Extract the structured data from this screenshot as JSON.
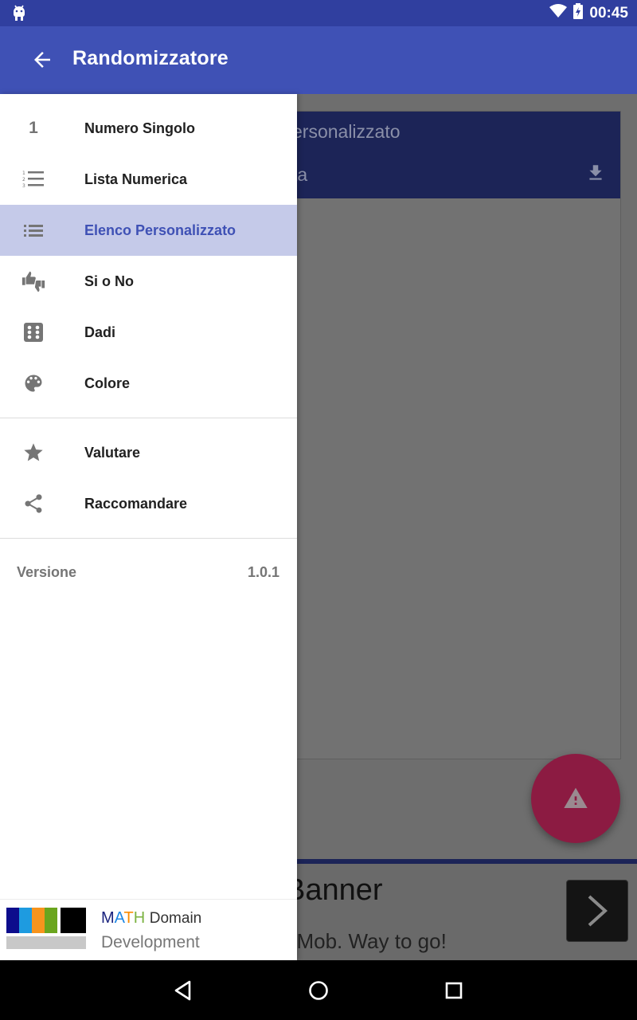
{
  "status_bar": {
    "time": "00:45",
    "icons": [
      "android-icon",
      "wifi-icon",
      "battery-charging-icon"
    ]
  },
  "app_bar": {
    "title": "Randomizzatore",
    "back_icon": "arrow-back-icon"
  },
  "drawer": {
    "primary_items": [
      {
        "icon": "1",
        "label": "Numero Singolo",
        "active": false
      },
      {
        "icon": "numbered-list-icon",
        "label": "Lista Numerica",
        "active": false
      },
      {
        "icon": "list-icon",
        "label": "Elenco Personalizzato",
        "active": true
      },
      {
        "icon": "thumbs-up-down-icon",
        "label": "Si o No",
        "active": false
      },
      {
        "icon": "dice-icon",
        "label": "Dadi",
        "active": false
      },
      {
        "icon": "palette-icon",
        "label": "Colore",
        "active": false
      }
    ],
    "secondary_items": [
      {
        "icon": "star-icon",
        "label": "Valutare"
      },
      {
        "icon": "share-icon",
        "label": "Raccomandare"
      }
    ],
    "version_label": "Versione",
    "version_value": "1.0.1",
    "footer": {
      "brand_m": "M",
      "brand_a": "A",
      "brand_t": "T",
      "brand_h": "H",
      "brand_domain": "Domain",
      "brand_sub": "Development",
      "logo_colors": [
        "#0d0d8c",
        "#1e9be0",
        "#f7941d",
        "#6aa51e",
        "#000000"
      ]
    }
  },
  "background": {
    "card_title_partial": "ersonalizzato",
    "card_sub_partial": "ta",
    "ad_title_partial": "Banner",
    "ad_text_partial": "dMob. Way to go!"
  },
  "colors": {
    "primary": "#3f51b5",
    "primary_dark": "#303f9f",
    "accent": "#c2185b",
    "active_bg": "#c5cae9"
  }
}
